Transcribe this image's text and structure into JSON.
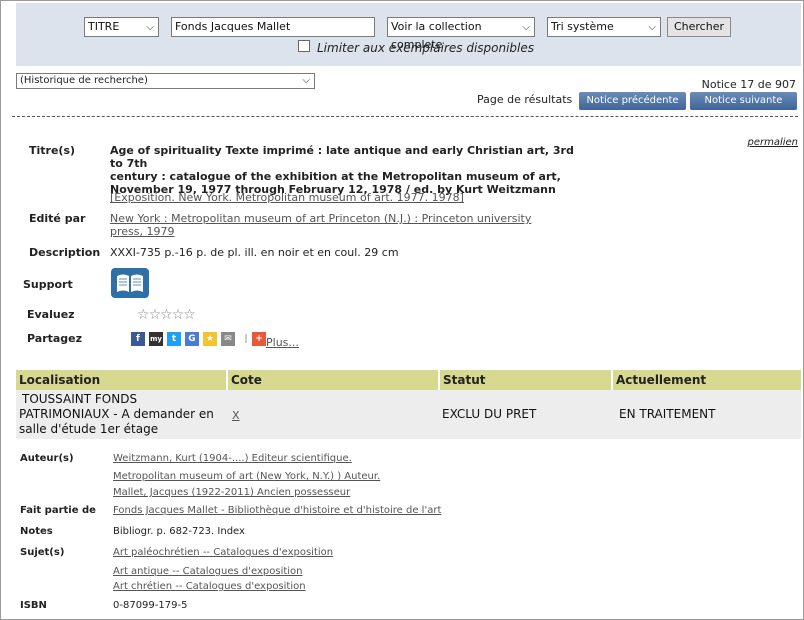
{
  "search": {
    "field_select": "TITRE",
    "query": "Fonds Jacques Mallet",
    "collection_select": "Voir la collection complete",
    "sort_select": "Tri système",
    "search_button": "Chercher",
    "limit_label": "Limiter aux exemplaires disponibles"
  },
  "history_select": "(Historique de recherche)",
  "notice_count": "Notice 17 de 907",
  "page_results_label": "Page de résultats",
  "prev_button": "Notice précédente",
  "next_button": "Notice suivante",
  "permalink": "permalien",
  "record": {
    "title_label": "Titre(s)",
    "title_value": "Age of spirituality Texte imprimé : late antique and early Christian art, 3rd to 7th century : catalogue of the exhibition at the Metropolitan museum of art, November 19, 1977 through February 12, 1978 / ed. by Kurt Weitzmann",
    "title_line1": "Age of spirituality Texte imprimé : late antique and early Christian art, 3rd to 7th",
    "title_line2": "century : catalogue of the exhibition at the Metropolitan museum of art,",
    "title_line3": "November 19, 1977 through February 12, 1978 / ed. by Kurt Weitzmann",
    "exhibition_link": "[Exposition. New York. Metropolitan museum of art. 1977. 1978]",
    "publisher_label": "Edité par",
    "publisher_line1": "New York : Metropolitan museum of art Princeton (N.J.) : Princeton university",
    "publisher_line2": "press, 1979",
    "description_label": "Description",
    "description_value": "XXXI-735 p.-16 p. de pl. ill. en noir et en coul. 29 cm",
    "support_label": "Support",
    "rate_label": "Evaluez",
    "share_label": "Partagez",
    "share_more": "Plus..."
  },
  "holdings": {
    "headers": [
      "Localisation",
      "Cote",
      "Statut",
      "Actuellement"
    ],
    "row": {
      "location_line1": "TOUSSAINT FONDS",
      "location_line2": "PATRIMONIAUX - A demander en",
      "location_line3": "salle d'étude 1er étage",
      "cote": "X",
      "status": "EXCLU DU PRET",
      "current": "EN TRAITEMENT"
    }
  },
  "details": {
    "authors_label": "Auteur(s)",
    "authors": [
      "Weitzmann, Kurt (1904-....) Editeur scientifique.",
      "Metropolitan museum of art (New York, N.Y.) ) Auteur.",
      "Mallet, Jacques (1922-2011) Ancien possesseur"
    ],
    "part_of_label": "Fait partie de",
    "part_of": "Fonds Jacques Mallet - Bibliothèque d'histoire et d'histoire de l'art",
    "notes_label": "Notes",
    "notes": "Bibliogr. p. 682-723. Index",
    "subjects_label": "Sujet(s)",
    "subjects": [
      "Art paléochrétien -- Catalogues d'exposition",
      "Art antique -- Catalogues d'exposition",
      "Art chrétien -- Catalogues d'exposition"
    ],
    "isbn_label": "ISBN",
    "isbn": "0-87099-179-5"
  },
  "colors": {
    "search_bg": "#dde3ec",
    "table_header_bg": "#d6d98f",
    "button_blue": "#4a6fa3"
  }
}
